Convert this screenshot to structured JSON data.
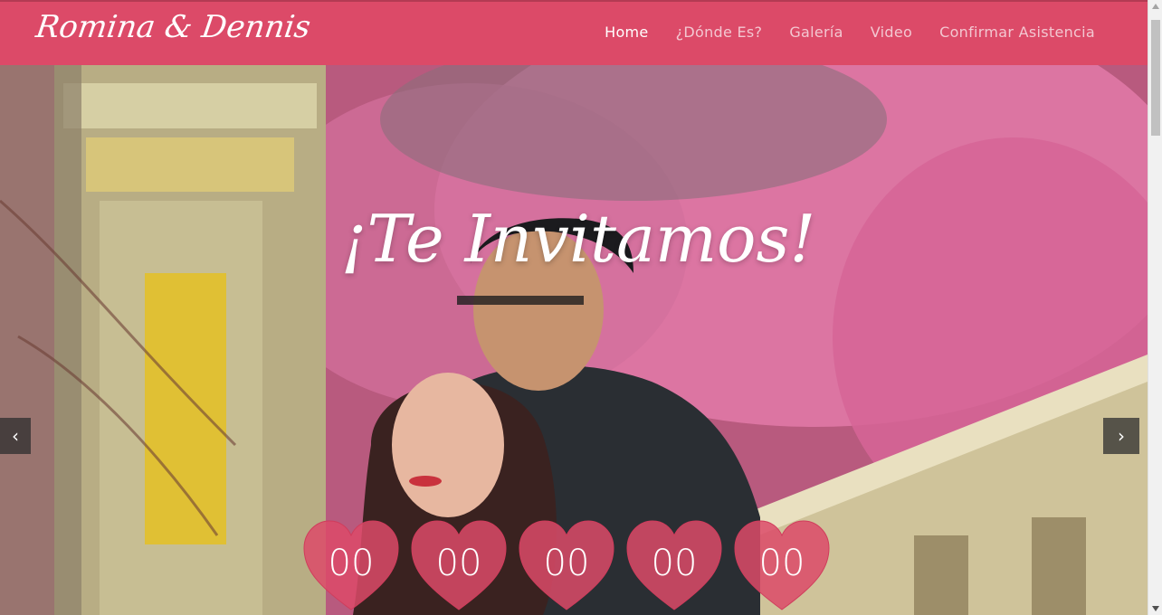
{
  "brand": {
    "name": "Romina & Dennis"
  },
  "nav": {
    "items": [
      {
        "label": "Home",
        "active": true
      },
      {
        "label": "¿Dónde Es?",
        "active": false
      },
      {
        "label": "Galería",
        "active": false
      },
      {
        "label": "Video",
        "active": false
      },
      {
        "label": "Confirmar Asistencia",
        "active": false
      }
    ]
  },
  "hero": {
    "title": "¡Te Invitamos!",
    "prev_icon": "chevron-left-icon",
    "next_icon": "chevron-right-icon"
  },
  "countdown": {
    "values": [
      "00",
      "00",
      "00",
      "00",
      "00"
    ],
    "heart_color": "#dc4a68"
  },
  "colors": {
    "navbar": "#dc4a68",
    "nav_text": "#f3c7d1",
    "nav_active": "#ffffff"
  }
}
